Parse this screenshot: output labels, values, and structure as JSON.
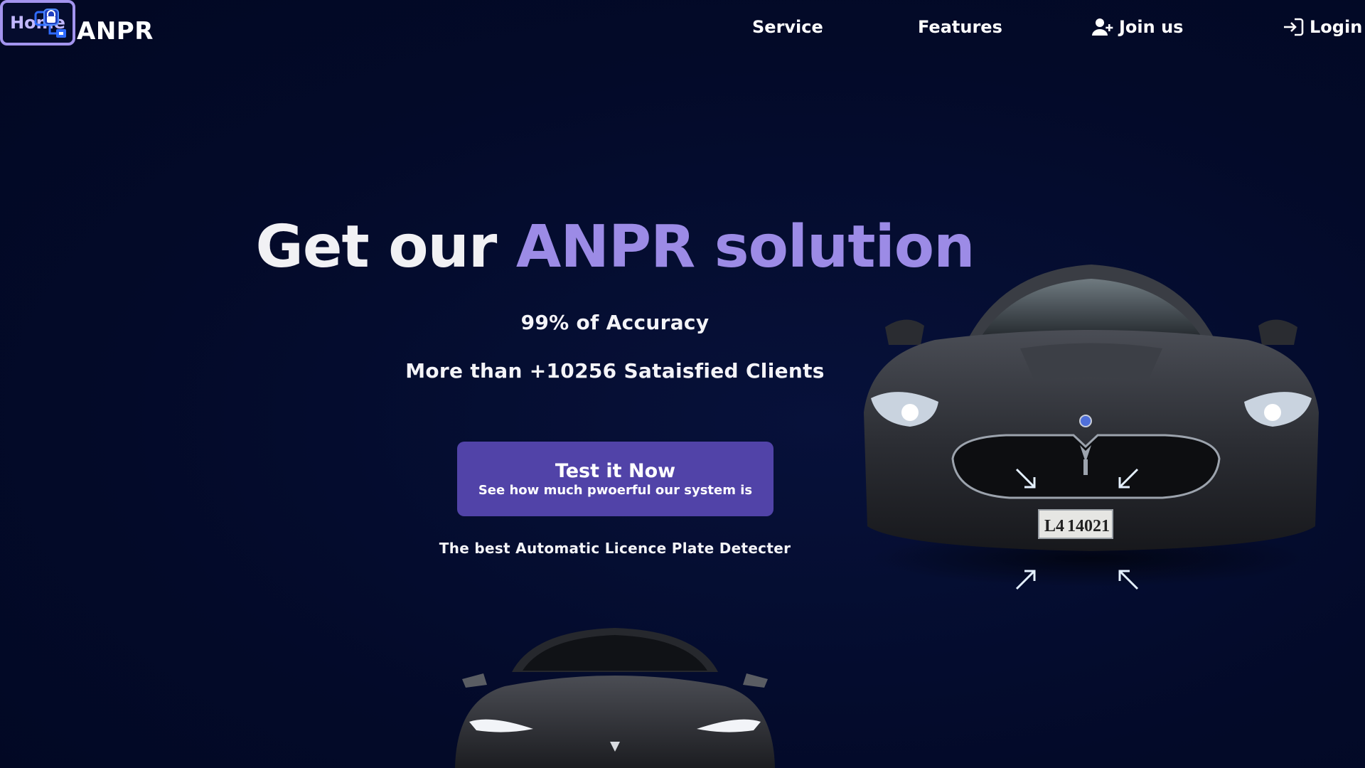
{
  "brand": {
    "name": "ANPR",
    "logo_icon": "network-security-icon"
  },
  "nav": {
    "home": "Home",
    "service": "Service",
    "features": "Features",
    "join": "Join us",
    "login": "Login",
    "join_icon": "user-plus-icon",
    "login_icon": "login-icon"
  },
  "hero": {
    "title_prefix": "Get our ",
    "title_accent": "ANPR solution",
    "stat_accuracy": "99% of Accuracy",
    "stat_clients": "More than +10256 Sataisfied Clients",
    "cta_title": "Test it Now",
    "cta_subtitle": "See how much pwoerful our system is",
    "tagline": "The best Automatic Licence Plate Detecter"
  },
  "car": {
    "plate_left": "L4",
    "plate_number": "14021"
  },
  "colors": {
    "background": "#030a29",
    "accent": "#9c8be6",
    "button": "#5143a8",
    "nav_active_border": "#a394ee"
  }
}
